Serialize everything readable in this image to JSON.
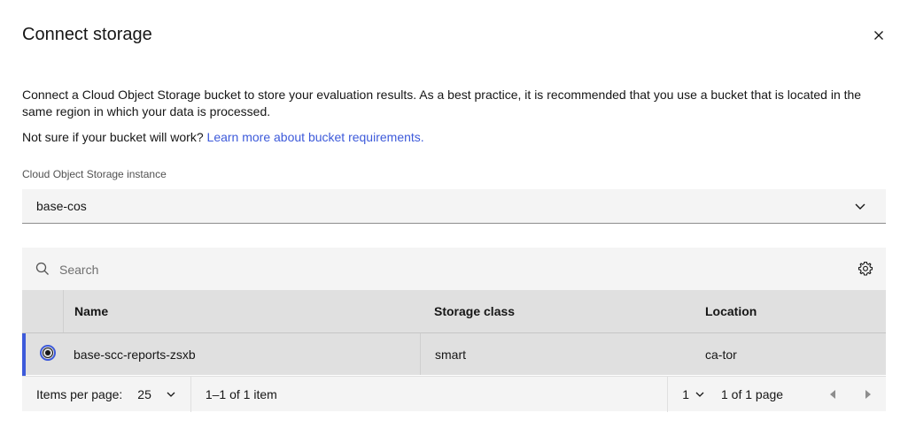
{
  "modal": {
    "title": "Connect storage",
    "description": "Connect a Cloud Object Storage bucket to store your evaluation results. As a best practice, it is recommended that you use a bucket that is located in the same region in which your data is processed.",
    "note_prefix": "Not sure if your bucket will work? ",
    "note_link": "Learn more about bucket requirements."
  },
  "instance_select": {
    "label": "Cloud Object Storage instance",
    "value": "base-cos"
  },
  "search": {
    "placeholder": "Search"
  },
  "table": {
    "headers": [
      "Name",
      "Storage class",
      "Location"
    ],
    "rows": [
      {
        "name": "base-scc-reports-zsxb",
        "storage_class": "smart",
        "location": "ca-tor",
        "selected": true
      }
    ]
  },
  "pagination": {
    "items_per_page_label": "Items per page:",
    "items_per_page": "25",
    "range": "1–1 of 1 item",
    "page": "1",
    "page_of": "1 of 1 page"
  },
  "colors": {
    "accent": "#3d5ada",
    "field_bg": "#f4f4f4",
    "table_bg": "#e0e0e0"
  }
}
